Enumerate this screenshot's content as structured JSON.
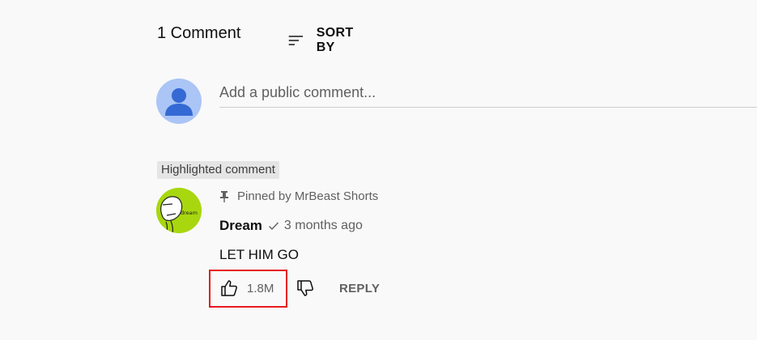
{
  "comments_header": {
    "count_label": "1 Comment",
    "sort_label": "SORT BY"
  },
  "composer": {
    "placeholder": "Add a public comment..."
  },
  "highlight_badge": "Highlighted comment",
  "comment": {
    "pinned_label": "Pinned by MrBeast Shorts",
    "author": "Dream",
    "time": "3 months ago",
    "avatar_text": "dream",
    "text": "LET HIM GO",
    "like_count": "1.8M",
    "reply_label": "REPLY"
  },
  "colors": {
    "background": "#f9f9f9",
    "secondary_text": "#606060",
    "annotation_box": "#e8191c",
    "author_avatar_bg": "#a8d70f",
    "user_avatar_bg": "#aac5f6"
  },
  "icons": [
    "sort-icon",
    "pin-icon",
    "verified-check-icon",
    "thumbs-up-icon",
    "thumbs-down-icon"
  ]
}
